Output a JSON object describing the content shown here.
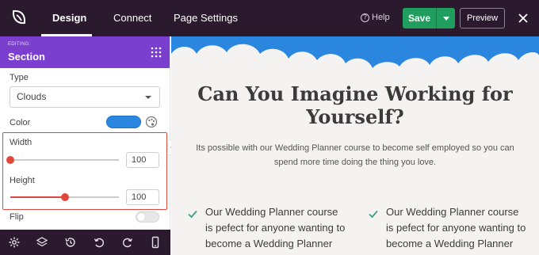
{
  "topbar": {
    "tabs": [
      {
        "label": "Design",
        "active": true
      },
      {
        "label": "Connect",
        "active": false
      },
      {
        "label": "Page Settings",
        "active": false
      }
    ],
    "help_label": "Help",
    "save_label": "Save",
    "preview_label": "Preview"
  },
  "sidebar": {
    "editing_label": "EDITING:",
    "editing_title": "Section",
    "type_label": "Type",
    "type_value": "Clouds",
    "color_label": "Color",
    "color_value": "#2b86e0",
    "width_label": "Width",
    "width_value": "100",
    "width_fraction": 0,
    "height_label": "Height",
    "height_value": "100",
    "height_fraction": 0.5,
    "flip_label": "Flip",
    "flip_on": false
  },
  "canvas": {
    "headline": "Can You Imagine Working for Yourself?",
    "subtext": "Its possible with our Wedding Planner course to become self employed so you can spend more time doing the thing you love.",
    "features": [
      "Our Wedding Planner course is pefect for anyone wanting to become a Wedding Planner",
      "Our Wedding Planner course is pefect for anyone wanting to become a Wedding Planner"
    ]
  },
  "colors": {
    "topbar": "#2b1a2e",
    "accent": "#7b3fd0",
    "save": "#1f9e5e",
    "highlight": "#e0473b",
    "sky": "#2b86e0"
  }
}
